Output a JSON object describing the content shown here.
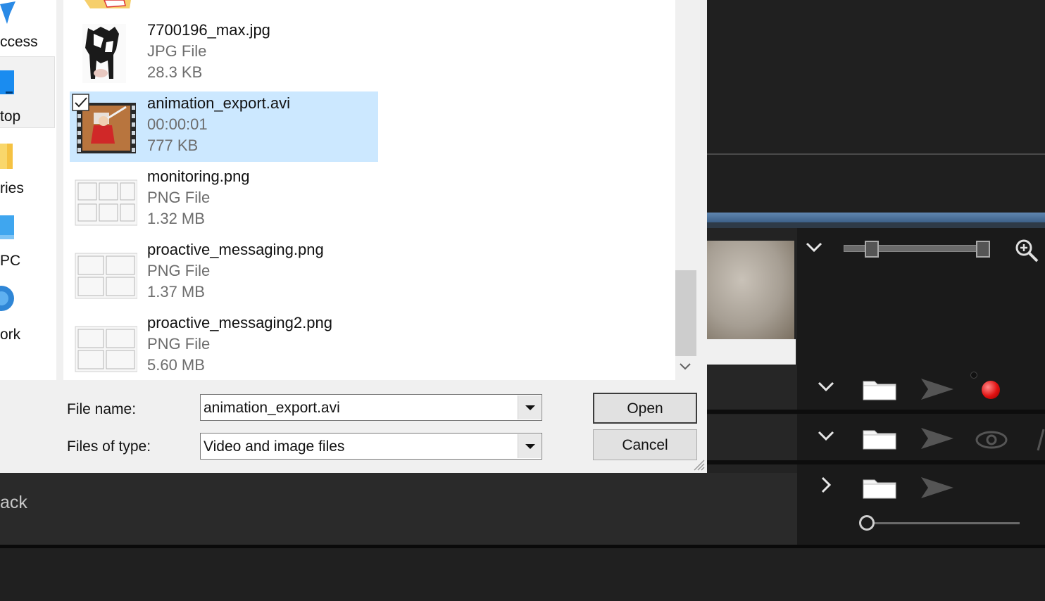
{
  "nav": {
    "items": [
      {
        "label": "ccess",
        "icon": "star-icon"
      },
      {
        "label": "top",
        "icon": "desktop-icon"
      },
      {
        "label": "ries",
        "icon": "libraries-icon"
      },
      {
        "label": "PC",
        "icon": "computer-icon"
      },
      {
        "label": "ork",
        "icon": "network-icon"
      }
    ]
  },
  "files": [
    {
      "name": "7700196_max.jpg",
      "line2": "JPG File",
      "line3": "28.3 KB",
      "thumb": "cow-image-thumbnail",
      "selected": false
    },
    {
      "name": "animation_export.avi",
      "line2": "00:00:01",
      "line3": "777 KB",
      "thumb": "video-thumbnail",
      "selected": true
    },
    {
      "name": "monitoring.png",
      "line2": "PNG File",
      "line3": "1.32 MB",
      "thumb": "sketch-thumbnail",
      "selected": false
    },
    {
      "name": "proactive_messaging.png",
      "line2": "PNG File",
      "line3": "1.37 MB",
      "thumb": "sketch-thumbnail",
      "selected": false
    },
    {
      "name": "proactive_messaging2.png",
      "line2": "PNG File",
      "line3": "5.60 MB",
      "thumb": "sketch-thumbnail",
      "selected": false
    }
  ],
  "form": {
    "file_name_label": "File name:",
    "file_name_value": "animation_export.avi",
    "file_type_label": "Files of type:",
    "file_type_value": "Video and image files",
    "open_label": "Open",
    "cancel_label": "Cancel"
  },
  "app": {
    "back_label": "ack"
  },
  "colors": {
    "selection": "#cce8ff",
    "record": "#e01010",
    "dialog_bg": "#f0f0f0"
  }
}
